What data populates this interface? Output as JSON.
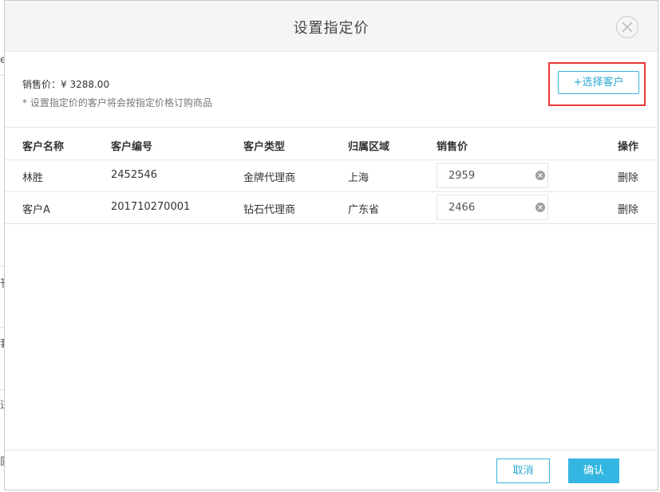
{
  "dialog": {
    "title": "设置指定价",
    "close_icon": "close-icon"
  },
  "info": {
    "sale_price_label": "销售价：¥ 3288.00",
    "note": "* 设置指定价的客户将会按指定价格订购商品"
  },
  "toolbar": {
    "select_customer_label": "+选择客户"
  },
  "table": {
    "headers": [
      "客户名称",
      "客户编号",
      "客户类型",
      "归属区域",
      "销售价",
      "操作"
    ],
    "rows": [
      {
        "name": "林胜",
        "code": "2452546",
        "type": "金牌代理商",
        "region": "上海",
        "price": "2959",
        "action": "删除"
      },
      {
        "name": "客户A",
        "code": "201710270001",
        "type": "钻石代理商",
        "region": "广东省",
        "price": "2466",
        "action": "删除"
      }
    ]
  },
  "footer": {
    "cancel_label": "取消",
    "confirm_label": "确认"
  },
  "background": {
    "edge_glyphs": [
      "e",
      "刊",
      "套",
      "道",
      "圊"
    ]
  },
  "colors": {
    "accent": "#35b6e2",
    "accent_text": "#29a8d4",
    "highlight_border": "#e53935"
  }
}
